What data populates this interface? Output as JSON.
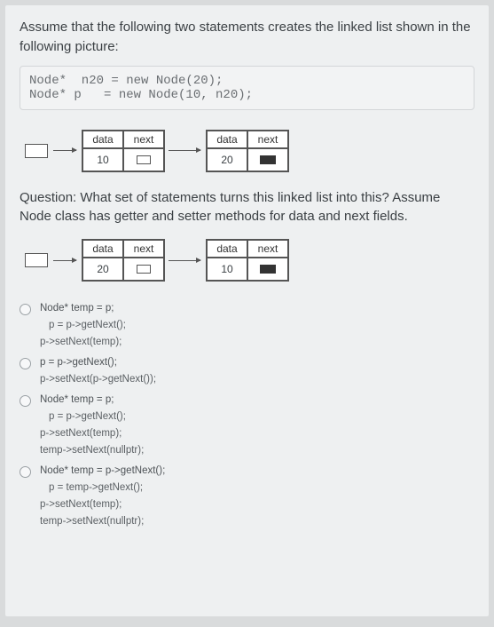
{
  "intro": "Assume that the following two statements creates the linked list shown in the following picture:",
  "code": "Node*  n20 = new Node(20);\nNode* p   = new Node(10, n20);",
  "node_labels": {
    "data": "data",
    "next": "next"
  },
  "list_before": {
    "n1": "10",
    "n2": "20"
  },
  "question": "Question: What set of statements turns this linked list into this? Assume Node class has getter and setter methods for data and next fields.",
  "list_after": {
    "n1": "20",
    "n2": "10"
  },
  "options": [
    {
      "lines": [
        "Node* temp = p;",
        "p = p->getNext();",
        "p->setNext(temp);"
      ]
    },
    {
      "lines": [
        "p = p->getNext();",
        "p->setNext(p->getNext());"
      ]
    },
    {
      "lines": [
        "Node* temp = p;",
        "p = p->getNext();",
        "p->setNext(temp);",
        "temp->setNext(nullptr);"
      ]
    },
    {
      "lines": [
        "Node* temp = p->getNext();",
        "p = temp->getNext();",
        "p->setNext(temp);",
        "temp->setNext(nullptr);"
      ]
    }
  ]
}
